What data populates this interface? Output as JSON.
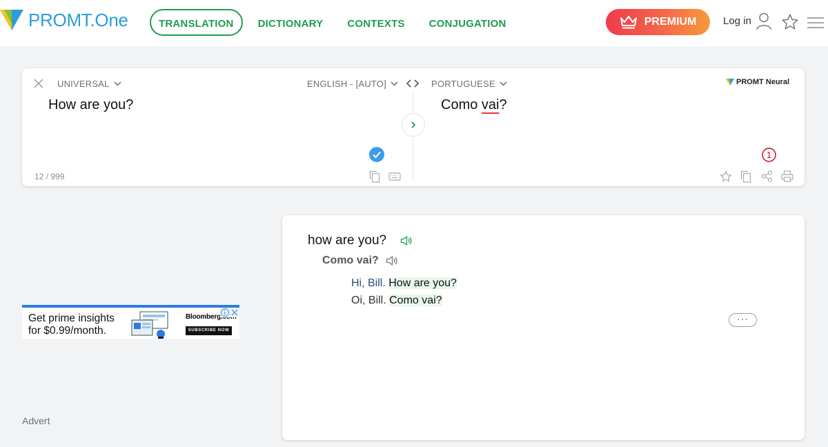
{
  "header": {
    "logo_text": "PROMT.One",
    "nav": [
      {
        "label": "TRANSLATION",
        "active": true
      },
      {
        "label": "DICTIONARY",
        "active": false
      },
      {
        "label": "CONTEXTS",
        "active": false
      },
      {
        "label": "CONJUGATION",
        "active": false
      }
    ],
    "premium_label": "PREMIUM",
    "login_label": "Log in",
    "icons": [
      "crown-icon",
      "user-icon",
      "star-icon",
      "menu-icon"
    ]
  },
  "translator": {
    "topic": "UNIVERSAL",
    "source_lang": "ENGLISH - [AUTO]",
    "target_lang": "PORTUGUESE",
    "source_text": "How are you?",
    "target_text_before": "Como ",
    "target_text_flagged": "vai",
    "target_text_after": "?",
    "char_counter": "12 / 999",
    "engine_label": "PROMT Neural",
    "badge_count": "1"
  },
  "ad": {
    "line1": "Get prime insights",
    "line2": "for $0.99/month.",
    "brand": "Bloomberg.com",
    "cta": "SUBSCRIBE NOW",
    "advert_label": "Advert"
  },
  "dictionary": {
    "phrase": "how are you?",
    "translation": "Como vai?",
    "example_en_plain": "Hi, Bill. ",
    "example_en_hl": "How are you?",
    "example_pt_plain": "Oi, Bill. ",
    "example_pt_hl": "Como vai?",
    "more_label": "···"
  },
  "colors": {
    "brand_green": "#1e9c4f",
    "logo_blue": "#2a9ed8",
    "premium_start": "#ef3a4b",
    "premium_end": "#f99a38",
    "check_blue": "#3d9be9",
    "badge_red": "#d0021b",
    "highlight": "#e8f6ec"
  }
}
